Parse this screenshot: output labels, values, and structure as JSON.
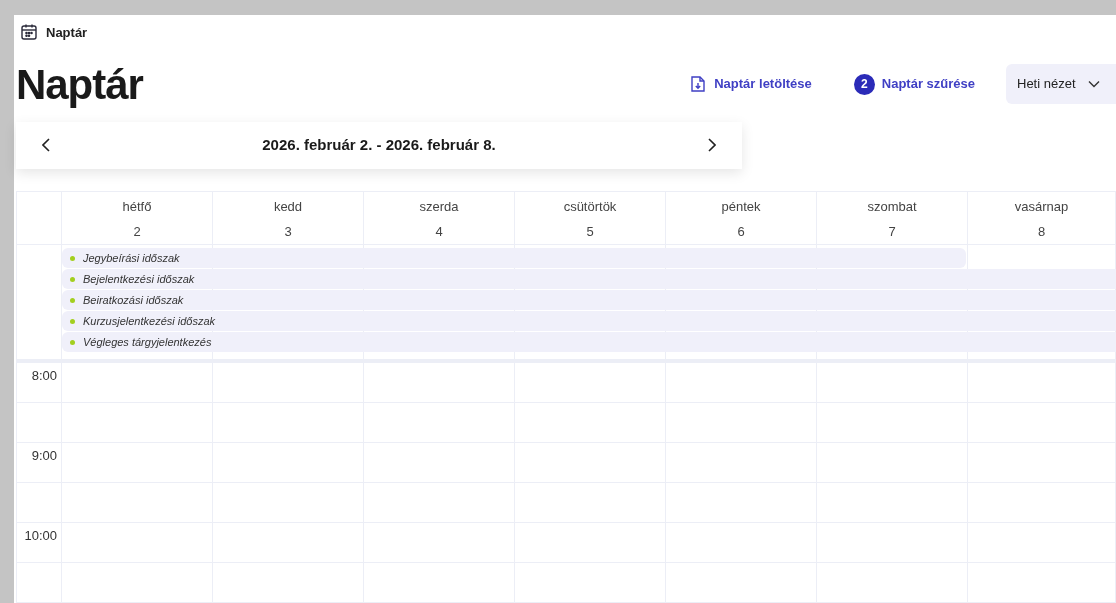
{
  "window": {
    "title": "Naptár"
  },
  "heading": "Naptár",
  "actions": {
    "download": "Naptár letöltése",
    "filter": {
      "count": "2",
      "label": "Naptár szűrése"
    },
    "view": "Heti nézet"
  },
  "week_nav": {
    "range": "2026. február 2. - 2026. február 8."
  },
  "days": [
    {
      "name": "hétfő",
      "date": "2"
    },
    {
      "name": "kedd",
      "date": "3"
    },
    {
      "name": "szerda",
      "date": "4"
    },
    {
      "name": "csütörtök",
      "date": "5"
    },
    {
      "name": "péntek",
      "date": "6"
    },
    {
      "name": "szombat",
      "date": "7"
    },
    {
      "name": "vasárnap",
      "date": "8"
    }
  ],
  "all_day_events": [
    {
      "title": "Jegybeírási időszak",
      "continues_after_week": false
    },
    {
      "title": "Bejelentkezési időszak",
      "continues_after_week": true
    },
    {
      "title": "Beiratkozási időszak",
      "continues_after_week": true
    },
    {
      "title": "Kurzusjelentkezési időszak",
      "continues_after_week": true
    },
    {
      "title": "Végleges tárgyjelentkezés",
      "continues_after_week": true
    }
  ],
  "times": [
    "8:00",
    "9:00",
    "10:00"
  ]
}
